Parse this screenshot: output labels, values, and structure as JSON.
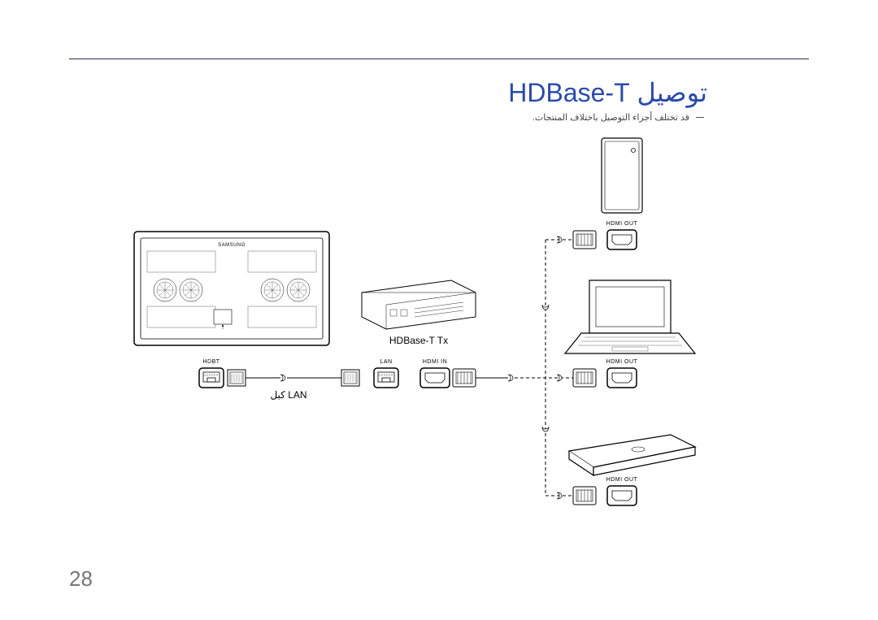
{
  "title": "توصيل HDBase-T",
  "note": "قد تختلف أجزاء التوصيل باختلاف المنتجات.",
  "labels": {
    "txbox": "HDBase-T Tx",
    "lan_cable": "كبل LAN",
    "hdbt": "HDBT",
    "lan": "LAN",
    "hdmi_in": "HDMI IN",
    "hdmi_out": "HDMI OUT",
    "brand": "SAMSUNG"
  },
  "page_number": "28"
}
